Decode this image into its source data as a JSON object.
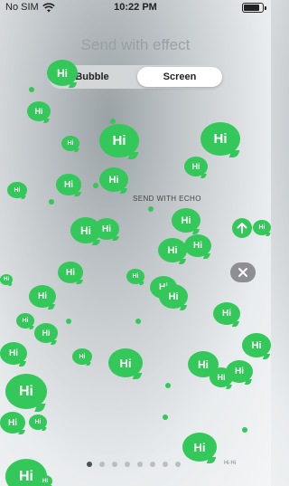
{
  "status_bar": {
    "carrier": "No SIM",
    "time": "10:22 PM",
    "battery_level": 0.9
  },
  "sheet": {
    "title": "Send with effect",
    "tabs": [
      {
        "label": "Bubble",
        "selected": false
      },
      {
        "label": "Screen",
        "selected": true
      }
    ],
    "effect_name": "SEND WITH ECHO"
  },
  "message": {
    "text": "Hi",
    "bubble_color": "#34c759"
  },
  "pagination": {
    "pages": 8,
    "current": 1,
    "indicator_text": "Hi Hi"
  },
  "icons": {
    "send": "arrow-up-icon",
    "close": "close-icon",
    "wifi": "wifi-icon",
    "battery": "battery-icon"
  },
  "colors": {
    "accent": "#34c759",
    "close_button": "#8e8e93"
  }
}
